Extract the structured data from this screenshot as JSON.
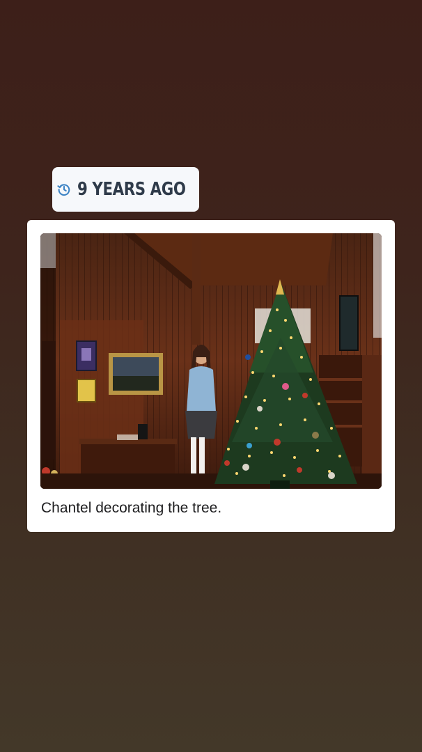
{
  "memory": {
    "badge_icon": "history-clock-icon",
    "badge_label": "9 YEARS AGO",
    "photo_caption": "Chantel decorating the tree."
  },
  "colors": {
    "badge_background": "#f6f8fb",
    "badge_icon": "#3b82c4",
    "badge_text": "#2f3b4a",
    "card_background": "#ffffff"
  }
}
